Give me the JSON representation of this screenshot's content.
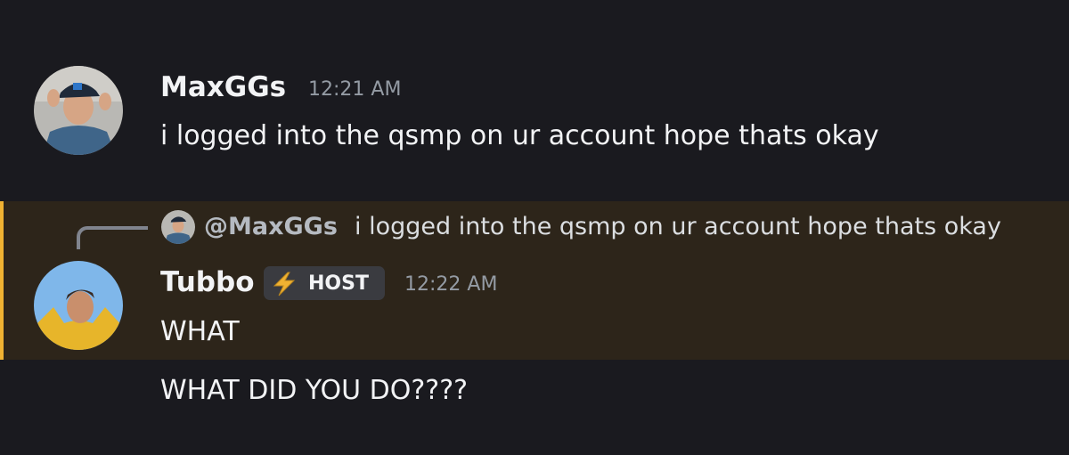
{
  "messages": [
    {
      "author": "MaxGGs",
      "timestamp": "12:21 AM",
      "content": "i logged into the qsmp on ur account hope thats okay"
    },
    {
      "reply": {
        "mention": "@MaxGGs",
        "text": "i logged into the qsmp on ur account hope thats okay"
      },
      "author": "Tubbo",
      "tag": {
        "icon": "lightning-bolt-icon",
        "label": "HOST"
      },
      "timestamp": "12:22 AM",
      "lines": [
        "WHAT",
        "WHAT DID YOU DO????"
      ]
    }
  ],
  "colors": {
    "background": "#1a1a1f",
    "highlight": "#2d251a",
    "highlight_border": "#f0b232",
    "tag_icon": "#f0b232"
  }
}
